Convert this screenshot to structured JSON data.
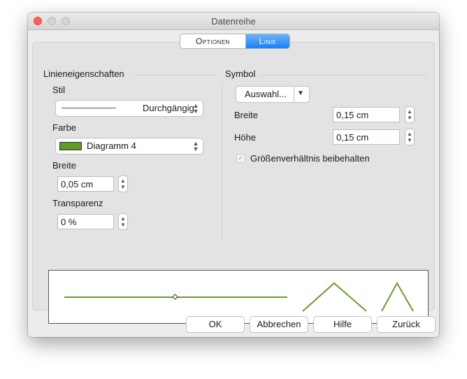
{
  "window": {
    "title": "Datenreihe"
  },
  "tabs": [
    {
      "label": "Optionen",
      "selected": false
    },
    {
      "label": "Linie",
      "selected": true
    }
  ],
  "line_props": {
    "title": "Linieneigenschaften",
    "style_label": "Stil",
    "style_value": "Durchgängig",
    "color_label": "Farbe",
    "color_value": "Diagramm 4",
    "color_swatch": "#5f9a2c",
    "width_label": "Breite",
    "width_value": "0,05 cm",
    "transparency_label": "Transparenz",
    "transparency_value": "0 %"
  },
  "symbol": {
    "title": "Symbol",
    "select_button": "Auswahl...",
    "width_label": "Breite",
    "width_value": "0,15 cm",
    "height_label": "Höhe",
    "height_value": "0,15 cm",
    "keep_ratio_label": "Größenverhältnis beibehalten",
    "keep_ratio_checked": true
  },
  "preview": {
    "line_color": "#6a9a34"
  },
  "buttons": {
    "ok": "OK",
    "cancel": "Abbrechen",
    "help": "Hilfe",
    "reset": "Zurück"
  }
}
